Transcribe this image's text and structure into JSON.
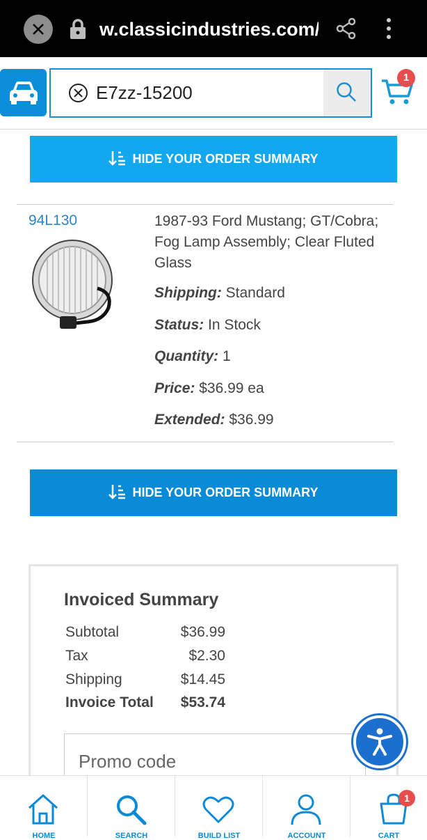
{
  "browser": {
    "url": "w.classicindustries.com/s",
    "icons": [
      "close-icon",
      "lock-icon",
      "share-icon",
      "more-vert-icon"
    ]
  },
  "header": {
    "search_value": "E7zz-15200",
    "cart_count": "1",
    "icons": [
      "car-icon",
      "clear-icon",
      "search-icon",
      "cart-icon"
    ]
  },
  "order_summary_toggle": {
    "label": "HIDE YOUR ORDER SUMMARY",
    "icon": "sort-down-icon"
  },
  "item": {
    "part_number": "94L130",
    "description": "1987-93 Ford Mustang; GT/Cobra; Fog Lamp Assembly; Clear Fluted Glass",
    "shipping_label": "Shipping:",
    "shipping_value": " Standard",
    "status_label": "Status:",
    "status_value": " In Stock",
    "quantity_label": "Quantity:",
    "quantity_value": " 1",
    "price_label": "Price:",
    "price_value": " $36.99 ea",
    "extended_label": "Extended:",
    "extended_value": " $36.99"
  },
  "invoice": {
    "title": "Invoiced Summary",
    "rows": [
      {
        "label": "Subtotal",
        "value": "$36.99"
      },
      {
        "label": "Tax",
        "value": "$2.30"
      },
      {
        "label": "Shipping",
        "value": "$14.45"
      },
      {
        "label": "Invoice Total",
        "value": "$53.74"
      }
    ],
    "promo_placeholder": "Promo code"
  },
  "bottom_nav": {
    "items": [
      {
        "label": "HOME",
        "icon": "home-icon"
      },
      {
        "label": "SEARCH",
        "icon": "search-icon"
      },
      {
        "label": "BUILD LIST",
        "icon": "heart-icon"
      },
      {
        "label": "ACCOUNT",
        "icon": "user-icon"
      },
      {
        "label": "CART",
        "icon": "cart-icon"
      }
    ],
    "cart_count": "1"
  },
  "colors": {
    "brand_blue": "#0a8bd8",
    "light_blue": "#12a8f0",
    "badge_red": "#e84d4d",
    "link_blue": "#2a86c7"
  }
}
